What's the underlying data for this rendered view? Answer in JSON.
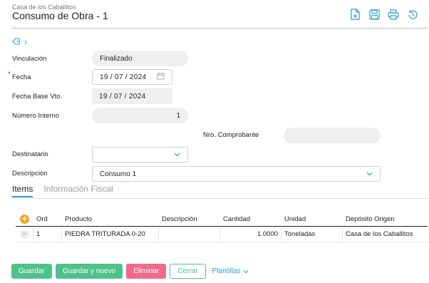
{
  "header": {
    "company": "Casa de los Caballitos",
    "title": "Consumo de Obra - 1",
    "icons": [
      "new-doc-icon",
      "save-icon",
      "print-icon",
      "history-icon"
    ]
  },
  "tags": {
    "icon": "tag-icon",
    "chevron": "›"
  },
  "form": {
    "vinculacion_label": "Vinculación",
    "vinculacion_value": "Finalizado",
    "fecha_label": "Fecha",
    "fecha_required": "*",
    "fecha_value": "19 / 07 / 2024",
    "fecha_base_label": "Fecha Base Vto.",
    "fecha_base_value": "19 / 07 / 2024",
    "numero_interno_label": "Número Interno",
    "numero_interno_value": "1",
    "nro_comprobante_label": "Nro. Comprobante",
    "nro_comprobante_value": "",
    "destinatario_label": "Destinatario",
    "destinatario_value": "",
    "descripcion_label": "Descripción",
    "descripcion_value": "Consumo 1"
  },
  "tabs": [
    {
      "label": "Items",
      "active": true
    },
    {
      "label": "Información Fiscal",
      "active": false
    }
  ],
  "grid": {
    "columns": [
      "Ord",
      "Producto",
      "Descripción",
      "Cantidad",
      "Unidad",
      "Depósito Origen"
    ],
    "rows": [
      {
        "ord": "1",
        "producto": "PIEDRA TRITURADA 0-20",
        "descripcion": "",
        "cantidad": "1.0000",
        "unidad": "Toneladas",
        "deposito": "Casa de los Caballitos"
      }
    ]
  },
  "buttons": {
    "guardar": "Guardar",
    "guardar_nuevo": "Guardar y nuevo",
    "eliminar": "Eliminar",
    "cerrar": "Cerrar",
    "plantillas": "Plantillas"
  },
  "colors": {
    "accent": "#2d9ad0",
    "green": "#4ec28b",
    "pink": "#f06a8a",
    "orange": "#f5a623"
  }
}
